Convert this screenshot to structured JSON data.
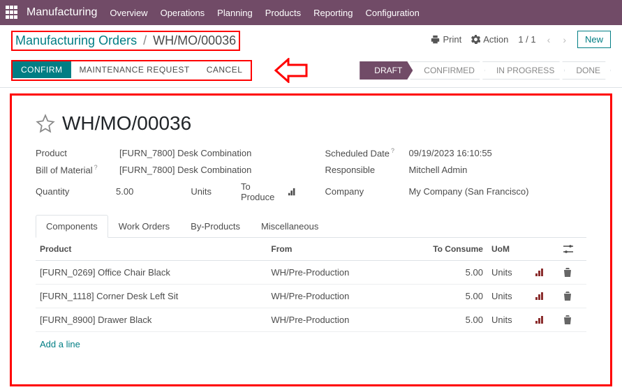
{
  "topbar": {
    "brand": "Manufacturing",
    "menu": [
      "Overview",
      "Operations",
      "Planning",
      "Products",
      "Reporting",
      "Configuration"
    ]
  },
  "breadcrumb": {
    "link": "Manufacturing Orders",
    "current": "WH/MO/00036"
  },
  "header_actions": {
    "print": "Print",
    "action": "Action",
    "pager": "1 / 1",
    "new": "New"
  },
  "buttons": {
    "confirm": "CONFIRM",
    "maintenance": "MAINTENANCE REQUEST",
    "cancel": "CANCEL"
  },
  "status": {
    "steps": [
      "DRAFT",
      "CONFIRMED",
      "IN PROGRESS",
      "DONE"
    ],
    "active_index": 0
  },
  "record": {
    "title": "WH/MO/00036",
    "fields_left": {
      "product_label": "Product",
      "product_value": "[FURN_7800] Desk Combination",
      "bom_label": "Bill of Material",
      "bom_value": "[FURN_7800] Desk Combination",
      "quantity_label": "Quantity",
      "quantity_value": "5.00",
      "quantity_uom": "Units",
      "to_produce": "To Produce"
    },
    "fields_right": {
      "scheduled_label": "Scheduled Date",
      "scheduled_value": "09/19/2023 16:10:55",
      "responsible_label": "Responsible",
      "responsible_value": "Mitchell Admin",
      "company_label": "Company",
      "company_value": "My Company (San Francisco)"
    }
  },
  "tabs": [
    "Components",
    "Work Orders",
    "By-Products",
    "Miscellaneous"
  ],
  "active_tab": 0,
  "table": {
    "headers": {
      "product": "Product",
      "from": "From",
      "to_consume": "To Consume",
      "uom": "UoM"
    },
    "rows": [
      {
        "product": "[FURN_0269] Office Chair Black",
        "from": "WH/Pre-Production",
        "to_consume": "5.00",
        "uom": "Units"
      },
      {
        "product": "[FURN_1118] Corner Desk Left Sit",
        "from": "WH/Pre-Production",
        "to_consume": "5.00",
        "uom": "Units"
      },
      {
        "product": "[FURN_8900] Drawer Black",
        "from": "WH/Pre-Production",
        "to_consume": "5.00",
        "uom": "Units"
      }
    ],
    "add_line": "Add a line"
  }
}
